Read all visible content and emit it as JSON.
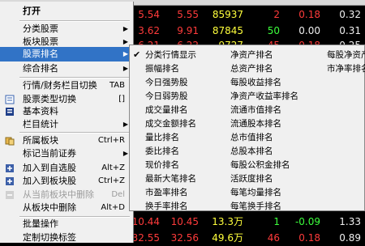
{
  "menu": {
    "items": [
      {
        "label": "打开",
        "accel": "",
        "arrow": false,
        "bold": true
      },
      {
        "label": "分类股票",
        "accel": "",
        "arrow": true
      },
      {
        "label": "板块股票",
        "accel": "",
        "arrow": true
      },
      {
        "label": "股票排名",
        "accel": "",
        "arrow": true,
        "highlight": true
      },
      {
        "label": "综合排名",
        "accel": "",
        "arrow": true
      },
      {
        "label": "行情/财务栏目切换",
        "accel": "TAB",
        "arrow": false
      },
      {
        "label": "股票类型切换",
        "accel": "[]",
        "arrow": false
      },
      {
        "label": "基本资料",
        "accel": "",
        "arrow": false
      },
      {
        "label": "栏目统计",
        "accel": "",
        "arrow": true
      },
      {
        "label": "所属板块",
        "accel": "Ctrl+R",
        "arrow": false
      },
      {
        "label": "标记当前证券",
        "accel": "",
        "arrow": true
      },
      {
        "label": "加入到自选股",
        "accel": "Alt+Z",
        "arrow": false
      },
      {
        "label": "加入到板块股",
        "accel": "Ctrl+Z",
        "arrow": false
      },
      {
        "label": "从当前板块中删除",
        "accel": "Del",
        "arrow": false,
        "disabled": true
      },
      {
        "label": "从板块中删除",
        "accel": "Alt+D",
        "arrow": false
      },
      {
        "label": "批量操作",
        "accel": "",
        "arrow": false
      },
      {
        "label": "定制切换标签",
        "accel": "",
        "arrow": false
      }
    ]
  },
  "submenu": {
    "columns": [
      [
        "分类行情显示",
        "振幅排名",
        "今日强势股",
        "今日弱势股",
        "成交量排名",
        "成交金额排名",
        "量比排名",
        "委比排名",
        "现价排名",
        "最新大笔排名",
        "市盈率排名",
        "换手率排名"
      ],
      [
        "净资产排名",
        "总资产排名",
        "每股收益排名",
        "净资产收益率排名",
        "流通市值排名",
        "流通股本排名",
        "总市值排名",
        "总股本排名",
        "每股公积金排名",
        "活跃度排名",
        "每笔均量排名",
        "每笔换手排名"
      ],
      [
        "每股净资产",
        "市净率排名"
      ]
    ],
    "checked": "分类行情显示"
  },
  "quotes": {
    "rows": [
      [
        "5.54",
        "5.55",
        "85937",
        "2",
        "0.18",
        "0.32"
      ],
      [
        "3.62",
        "9.91",
        "87845",
        "50",
        "0.00",
        "0.31"
      ],
      [
        "6.21",
        "6.22",
        "9727",
        "45",
        "0.18",
        "0.25"
      ],
      [
        "10.44",
        "10.45",
        "13.3万",
        "1",
        "-0.09",
        "1.33"
      ],
      [
        "32.55",
        "32.56",
        "49.6万",
        "46",
        "0.18",
        "0.89"
      ]
    ]
  },
  "colors": {
    "menu_bg": "#f0f0f0",
    "highlight": "#3173c6",
    "up": "#ff3b3b",
    "volume": "#ffff3c"
  }
}
